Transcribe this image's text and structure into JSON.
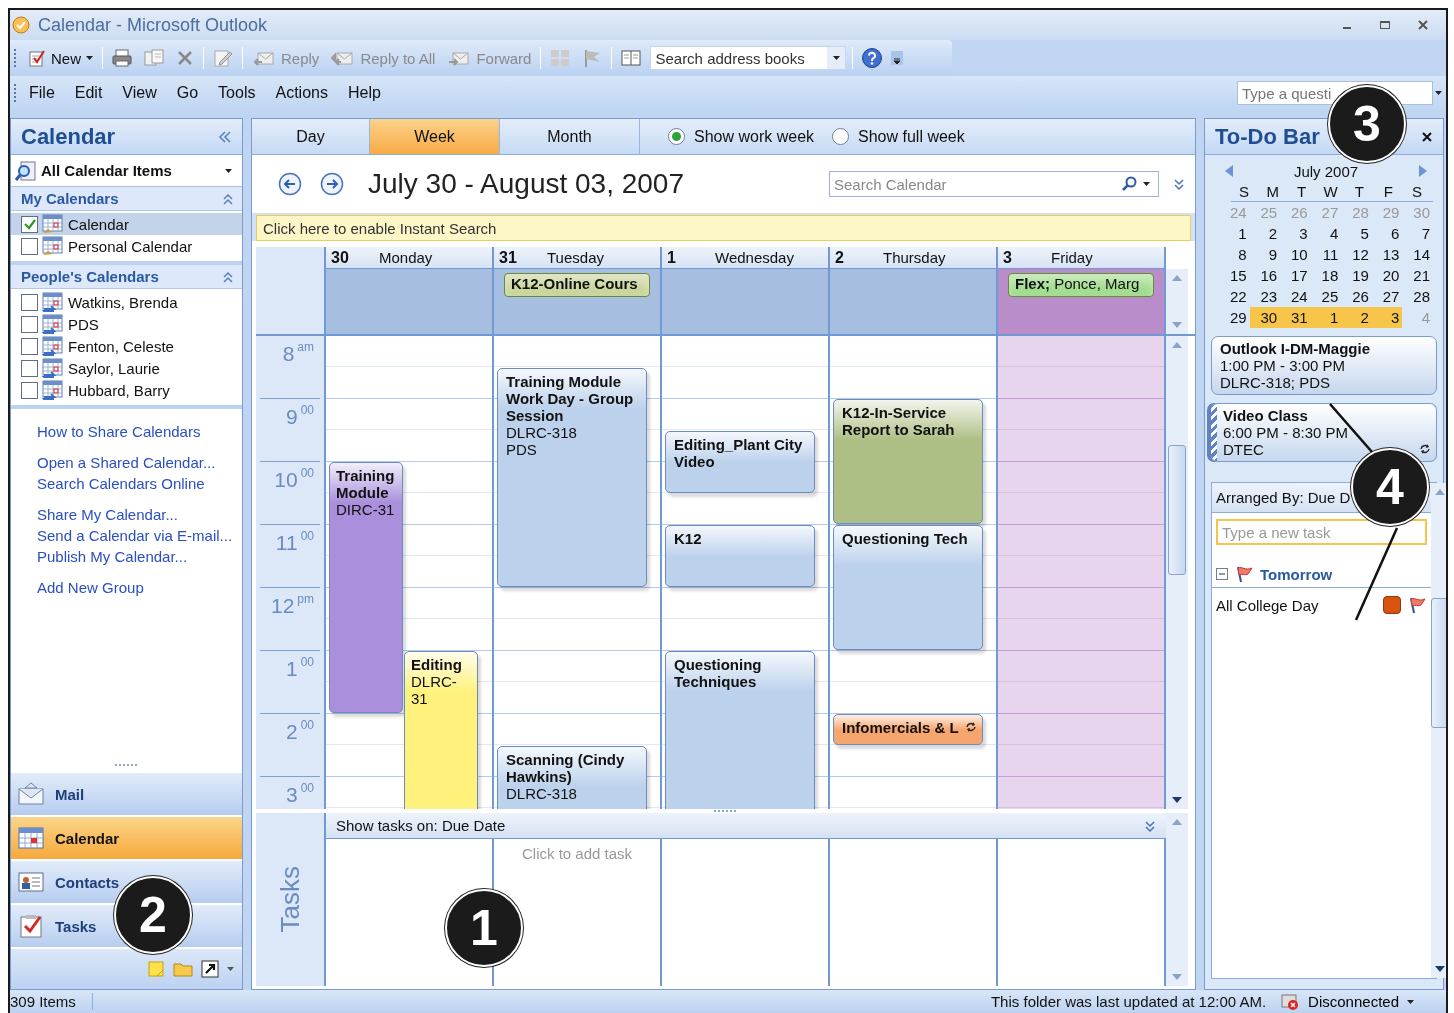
{
  "window": {
    "title": "Calendar - Microsoft Outlook"
  },
  "toolbar": {
    "buttons": [
      {
        "label": "New",
        "disabled": false
      },
      {
        "label": "Reply",
        "disabled": true
      },
      {
        "label": "Reply to All",
        "disabled": true
      },
      {
        "label": "Forward",
        "disabled": true
      }
    ],
    "address_search": {
      "placeholder": "Search address books"
    }
  },
  "menu": [
    "File",
    "Edit",
    "View",
    "Go",
    "Tools",
    "Actions",
    "Help"
  ],
  "help_search": {
    "placeholder": "Type a questi"
  },
  "navigation": {
    "title": "Calendar",
    "view_filter": "All Calendar Items",
    "groups": [
      {
        "title": "My Calendars",
        "items": [
          {
            "label": "Calendar",
            "checked": true,
            "selected": true
          },
          {
            "label": "Personal Calendar",
            "checked": false,
            "selected": false
          }
        ]
      },
      {
        "title": "People's Calendars",
        "items": [
          {
            "label": "Watkins, Brenda",
            "checked": false,
            "selected": false
          },
          {
            "label": "PDS",
            "checked": false,
            "selected": false
          },
          {
            "label": "Fenton, Celeste",
            "checked": false,
            "selected": false
          },
          {
            "label": "Saylor, Laurie",
            "checked": false,
            "selected": false
          },
          {
            "label": "Hubbard, Barry",
            "checked": false,
            "selected": false
          }
        ]
      }
    ],
    "link_groups": [
      [
        "How to Share Calendars"
      ],
      [
        "Open a Shared Calendar...",
        "Search Calendars Online"
      ],
      [
        "Share My Calendar...",
        "Send a Calendar via E-mail...",
        "Publish My Calendar..."
      ],
      [
        "Add New Group"
      ]
    ],
    "buttons": [
      {
        "label": "Mail",
        "selected": false
      },
      {
        "label": "Calendar",
        "selected": true
      },
      {
        "label": "Contacts",
        "selected": false
      },
      {
        "label": "Tasks",
        "selected": false
      }
    ]
  },
  "calendar": {
    "views": [
      {
        "label": "Day",
        "selected": false
      },
      {
        "label": "Week",
        "selected": true
      },
      {
        "label": "Month",
        "selected": false
      }
    ],
    "week_options": [
      {
        "label": "Show work week",
        "selected": true
      },
      {
        "label": "Show full week",
        "selected": false
      }
    ],
    "range_title": "July 30 - August 03, 2007",
    "search": {
      "placeholder": "Search Calendar"
    },
    "instant_search_bar": "Click here to enable Instant Search",
    "hours": [
      "8$^{am}$",
      "9$^{00}$",
      "10$^{00}$",
      "11$^{00}$",
      "12$^{pm}$",
      "1$^{00}$",
      "2$^{00}$",
      "3$^{00}$"
    ],
    "days": [
      {
        "date": "30",
        "weekday": "Monday",
        "out_of_office": false,
        "events": [
          {
            "title": "Training Module",
            "details": [
              "DIRC-31"
            ],
            "color": "#a98fdc"
          },
          {
            "title": "Editing",
            "details": [
              "DLRC-31"
            ],
            "color": "#fff27c"
          }
        ]
      },
      {
        "date": "31",
        "weekday": "Tuesday",
        "out_of_office": false,
        "all_day": [
          {
            "title": "K12-Online Cours",
            "color": "#cbd59e"
          }
        ],
        "events": [
          {
            "title": "Training Module Work Day - Group Session",
            "details": [
              "DLRC-318",
              "PDS"
            ],
            "color": "#bcd1ec"
          },
          {
            "title": "Scanning (Cindy Hawkins)",
            "details": [
              "DLRC-318"
            ],
            "color": "#bcd1ec"
          }
        ]
      },
      {
        "date": "1",
        "weekday": "Wednesday",
        "out_of_office": false,
        "events": [
          {
            "title": "Editing_Plant City Video",
            "color": "#bcd1ec"
          },
          {
            "title": "K12",
            "color": "#bcd1ec"
          },
          {
            "title": "Questioning Techniques",
            "color": "#bcd1ec"
          }
        ]
      },
      {
        "date": "2",
        "weekday": "Thursday",
        "out_of_office": false,
        "events": [
          {
            "title": "K12-In-Service Report to Sarah",
            "color": "#aebf85"
          },
          {
            "title": "Questioning Tech",
            "color": "#bcd1ec"
          },
          {
            "title": "Infomercials & L",
            "color": "#f7a56e",
            "recurring": true
          }
        ]
      },
      {
        "date": "3",
        "weekday": "Friday",
        "out_of_office": true,
        "all_day": [
          {
            "title": "**Flex;** Ponce, Marg",
            "color": "#a3dd90"
          }
        ]
      }
    ],
    "tasks": {
      "header": "Show tasks on: Due Date",
      "label": "Tasks",
      "hint": "Click to add task"
    }
  },
  "todo_bar": {
    "title": "To-Do Bar",
    "month": {
      "title": "July 2007",
      "weekdays": [
        "S",
        "M",
        "T",
        "W",
        "T",
        "F",
        "S"
      ],
      "weeks": [
        [
          {
            "day": "24",
            "muted": true,
            "selected": false
          },
          {
            "day": "25",
            "muted": true,
            "selected": false
          },
          {
            "day": "26",
            "muted": true,
            "selected": false
          },
          {
            "day": "27",
            "muted": true,
            "selected": false
          },
          {
            "day": "28",
            "muted": true,
            "selected": false
          },
          {
            "day": "29",
            "muted": true,
            "selected": false
          },
          {
            "day": "30",
            "muted": true,
            "selected": false
          }
        ],
        [
          {
            "day": "1",
            "muted": false,
            "selected": false
          },
          {
            "day": "2",
            "muted": false,
            "selected": false
          },
          {
            "day": "3",
            "muted": false,
            "selected": false
          },
          {
            "day": "4",
            "muted": false,
            "selected": false
          },
          {
            "day": "5",
            "muted": false,
            "selected": false
          },
          {
            "day": "6",
            "muted": false,
            "selected": false
          },
          {
            "day": "7",
            "muted": false,
            "selected": false
          }
        ],
        [
          {
            "day": "8",
            "muted": false,
            "selected": false
          },
          {
            "day": "9",
            "muted": false,
            "selected": false
          },
          {
            "day": "10",
            "muted": false,
            "selected": false
          },
          {
            "day": "11",
            "muted": false,
            "selected": false
          },
          {
            "day": "12",
            "muted": false,
            "selected": false
          },
          {
            "day": "13",
            "muted": false,
            "selected": false
          },
          {
            "day": "14",
            "muted": false,
            "selected": false
          }
        ],
        [
          {
            "day": "15",
            "muted": false,
            "selected": false
          },
          {
            "day": "16",
            "muted": false,
            "selected": false
          },
          {
            "day": "17",
            "muted": false,
            "selected": false
          },
          {
            "day": "18",
            "muted": false,
            "selected": false
          },
          {
            "day": "19",
            "muted": false,
            "selected": false
          },
          {
            "day": "20",
            "muted": false,
            "selected": false
          },
          {
            "day": "21",
            "muted": false,
            "selected": false
          }
        ],
        [
          {
            "day": "22",
            "muted": false,
            "selected": false
          },
          {
            "day": "23",
            "muted": false,
            "selected": false
          },
          {
            "day": "24",
            "muted": false,
            "selected": false
          },
          {
            "day": "25",
            "muted": false,
            "selected": false
          },
          {
            "day": "26",
            "muted": false,
            "selected": false
          },
          {
            "day": "27",
            "muted": false,
            "selected": false
          },
          {
            "day": "28",
            "muted": false,
            "selected": false
          }
        ],
        [
          {
            "day": "29",
            "muted": false,
            "selected": false
          },
          {
            "day": "30",
            "muted": false,
            "selected": true
          },
          {
            "day": "31",
            "muted": false,
            "selected": true
          },
          {
            "day": "1",
            "muted": false,
            "selected": true
          },
          {
            "day": "2",
            "muted": false,
            "selected": true
          },
          {
            "day": "3",
            "muted": false,
            "selected": true
          },
          {
            "day": "4",
            "muted": true,
            "selected": false
          }
        ]
      ]
    },
    "appointments": [
      {
        "title": "Outlook I-DM-Maggie",
        "time": "1:00 PM - 3:00 PM",
        "location": "DLRC-318; PDS",
        "tentative": false,
        "recurring": false
      },
      {
        "title": "Video Class",
        "time": "6:00 PM - 8:30 PM",
        "location": "DTEC",
        "tentative": true,
        "recurring": true
      }
    ],
    "tasks": {
      "arranged_by": "Arranged By: Due D",
      "new_task": {
        "placeholder": "Type a new task"
      },
      "groups": [
        {
          "title": "Tomorrow",
          "expanded": true,
          "tasks": [
            {
              "title": "All College Day",
              "color": "#d9530f"
            }
          ]
        }
      ]
    }
  },
  "status_bar": {
    "items": "309 Items",
    "message": "This folder was last updated at 12:00 AM.",
    "connection": "Disconnected"
  },
  "callouts": [
    "1",
    "2",
    "3",
    "4"
  ]
}
